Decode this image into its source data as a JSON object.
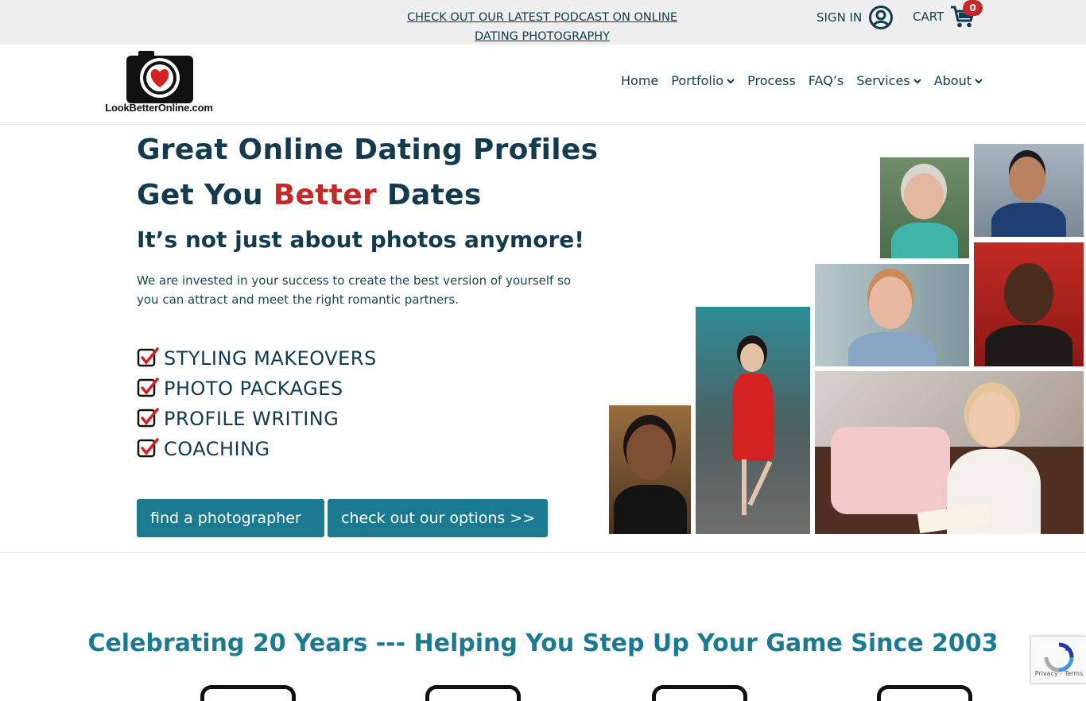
{
  "topbar": {
    "promo_line1": "CHECK OUT OUR LATEST PODCAST ON ONLINE",
    "promo_line2": "DATING PHOTOGRAPHY",
    "signin_label": "SIGN IN",
    "cart_label": "CART",
    "cart_count": "0"
  },
  "logo": {
    "text": "LookBetterOnline.com"
  },
  "nav": {
    "items": [
      {
        "label": "Home"
      },
      {
        "label": "Portfolio"
      },
      {
        "label": "Process"
      },
      {
        "label": "FAQ’s"
      },
      {
        "label": "Services"
      },
      {
        "label": "About"
      }
    ]
  },
  "hero": {
    "title_line1": "Great Online Dating Profiles",
    "title_line2_pre": "Get You",
    "title_line2_accent": "Better",
    "title_line2_post": "Dates",
    "subtitle": "It’s not just about photos anymore!",
    "description": "We are invested in your success to create the best version of yourself so you can attract and meet the right romantic partners.",
    "services": [
      "STYLING MAKEOVERS",
      "PHOTO PACKAGES",
      "PROFILE WRITING",
      "COACHING"
    ],
    "button_find": "find a photographer",
    "button_options": "check out our options >>"
  },
  "celebrate": {
    "text": "Celebrating 20 Years --- Helping You Step Up Your Game Since 2003"
  },
  "recaptcha": {
    "links": "Privacy - Terms"
  },
  "colors": {
    "navy": "#133a4d",
    "accent_red": "#c62828",
    "teal": "#1b7a8f",
    "topbar_bg": "#eeeeee"
  },
  "icons": {
    "signin": "user-circle-icon",
    "cart": "shopping-cart-icon",
    "check": "check-icon",
    "chevron": "chevron-down-icon"
  }
}
